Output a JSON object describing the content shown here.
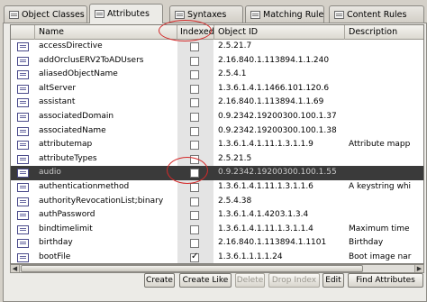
{
  "tabs": [
    {
      "label": "Object Classes",
      "active": false
    },
    {
      "label": "Attributes",
      "active": true
    },
    {
      "label": "Syntaxes",
      "active": false
    },
    {
      "label": "Matching Rules",
      "active": false
    },
    {
      "label": "Content Rules",
      "active": false
    }
  ],
  "table": {
    "columns": [
      "Name",
      "Indexed",
      "Object ID",
      "Description"
    ],
    "rows": [
      {
        "name": "accessDirective",
        "indexed": false,
        "oid": "2.5.21.7",
        "desc": ""
      },
      {
        "name": "addOrclusERV2ToADUsers",
        "indexed": false,
        "oid": "2.16.840.1.113894.1.1.240",
        "desc": ""
      },
      {
        "name": "aliasedObjectName",
        "indexed": false,
        "oid": "2.5.4.1",
        "desc": ""
      },
      {
        "name": "altServer",
        "indexed": false,
        "oid": "1.3.6.1.4.1.1466.101.120.6",
        "desc": ""
      },
      {
        "name": "assistant",
        "indexed": false,
        "oid": "2.16.840.1.113894.1.1.69",
        "desc": ""
      },
      {
        "name": "associatedDomain",
        "indexed": false,
        "oid": "0.9.2342.19200300.100.1.37",
        "desc": ""
      },
      {
        "name": "associatedName",
        "indexed": false,
        "oid": "0.9.2342.19200300.100.1.38",
        "desc": ""
      },
      {
        "name": "attributemap",
        "indexed": false,
        "oid": "1.3.6.1.4.1.11.1.3.1.1.9",
        "desc": "Attribute mapp"
      },
      {
        "name": "attributeTypes",
        "indexed": false,
        "oid": "2.5.21.5",
        "desc": ""
      },
      {
        "name": "audio",
        "indexed": false,
        "oid": "0.9.2342.19200300.100.1.55",
        "desc": "",
        "selected": true
      },
      {
        "name": "authenticationmethod",
        "indexed": false,
        "oid": "1.3.6.1.4.1.11.1.3.1.1.6",
        "desc": "A keystring whi"
      },
      {
        "name": "authorityRevocationList;binary",
        "indexed": false,
        "oid": "2.5.4.38",
        "desc": ""
      },
      {
        "name": "authPassword",
        "indexed": false,
        "oid": "1.3.6.1.4.1.4203.1.3.4",
        "desc": ""
      },
      {
        "name": "bindtimelimit",
        "indexed": false,
        "oid": "1.3.6.1.4.1.11.1.3.1.1.4",
        "desc": "Maximum time"
      },
      {
        "name": "birthday",
        "indexed": false,
        "oid": "2.16.840.1.113894.1.1101",
        "desc": "Birthday"
      },
      {
        "name": "bootFile",
        "indexed": true,
        "oid": "1.3.6.1.1.1.1.24",
        "desc": "Boot image nar"
      }
    ]
  },
  "buttons": [
    {
      "label": "Create",
      "enabled": true
    },
    {
      "label": "Create Like",
      "enabled": true
    },
    {
      "label": "Delete",
      "enabled": false
    },
    {
      "label": "Drop Index",
      "enabled": false
    },
    {
      "label": "Edit",
      "enabled": true
    },
    {
      "label": "Find Attributes",
      "enabled": true
    }
  ],
  "annotation_color": "#d42a2a",
  "selection_color": "#3a3a3a"
}
